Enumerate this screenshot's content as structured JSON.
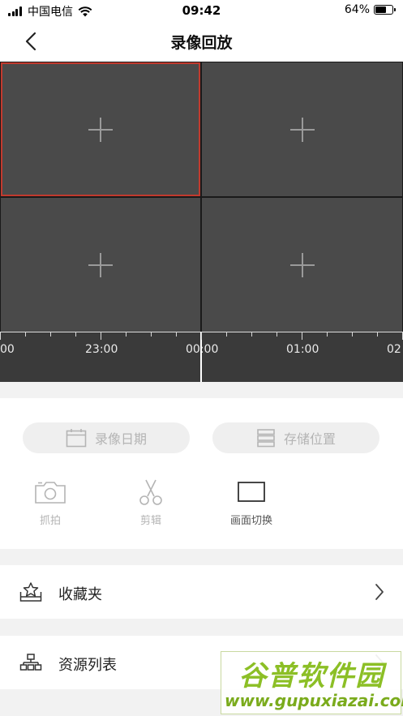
{
  "status_bar": {
    "carrier": "中国电信",
    "time": "09:42",
    "battery_text": "64%",
    "battery_level": 0.64
  },
  "nav": {
    "title": "录像回放",
    "back_icon": "chevron-left-icon"
  },
  "video_grid": {
    "cells": [
      {
        "icon": "plus-icon",
        "selected": true
      },
      {
        "icon": "plus-icon",
        "selected": false
      },
      {
        "icon": "plus-icon",
        "selected": false
      },
      {
        "icon": "plus-icon",
        "selected": false
      }
    ],
    "selected_color": "#c23a2e"
  },
  "timeline": {
    "labels": [
      "00",
      "23:00",
      "00:00",
      "01:00",
      "02"
    ],
    "cursor_time": "00:00"
  },
  "controls": {
    "record_date_label": "录像日期",
    "storage_location_label": "存储位置",
    "tools": {
      "snapshot": "抓拍",
      "clip": "剪辑",
      "switch_view": "画面切换"
    }
  },
  "list": {
    "favorites": "收藏夹",
    "resource_list": "资源列表"
  },
  "watermark": {
    "title": "谷普软件园",
    "url": "www.gupuxiazai.com"
  },
  "colors": {
    "accent_red": "#c23a2e",
    "grid_bg": "#4a4a4a",
    "timeline_bg": "#3a3a3a",
    "disabled_text": "#b4b4b4"
  }
}
